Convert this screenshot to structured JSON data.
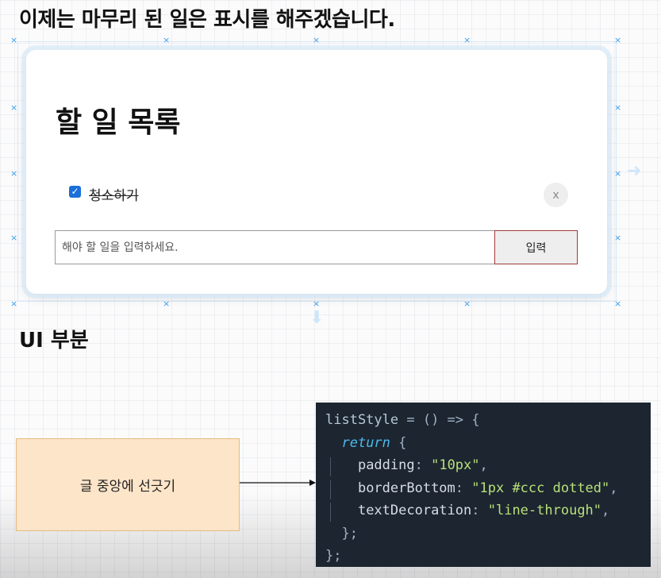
{
  "heading": "이제는 마무리 된 일은 표시를 해주겠습니다.",
  "todo_app": {
    "title": "할 일 목록",
    "items": [
      {
        "text": "청소하기",
        "completed": true,
        "delete_label": "x"
      }
    ],
    "input": {
      "placeholder": "해야 할 일을 입력하세요.",
      "value": ""
    },
    "submit_label": "입력"
  },
  "section_label": "UI 부분",
  "note_box": {
    "text": "글 중앙에 선긋기"
  },
  "code": {
    "line1": {
      "name": "listStyle",
      "rest": " = () => {"
    },
    "line2": {
      "keyword": "return",
      "rest": " {"
    },
    "line3": {
      "prop": "padding",
      "value": "\"10px\""
    },
    "line4": {
      "prop": "borderBottom",
      "value": "\"1px #ccc dotted\""
    },
    "line5": {
      "prop": "textDecoration",
      "value": "\"line-through\""
    },
    "line6": "};",
    "line7": "};"
  },
  "colors": {
    "checkbox_accent": "#1a6ed8",
    "note_background": "#fde5c9",
    "code_background": "#1c2530",
    "string_color": "#b8e07a",
    "keyword_color": "#4fb8e9",
    "submit_border": "#a33a3a",
    "marker_color": "#3aa0ee"
  },
  "icons": {
    "checkbox": "checkmark-icon",
    "delete": "close-icon",
    "connector": "arrow-right-icon"
  }
}
